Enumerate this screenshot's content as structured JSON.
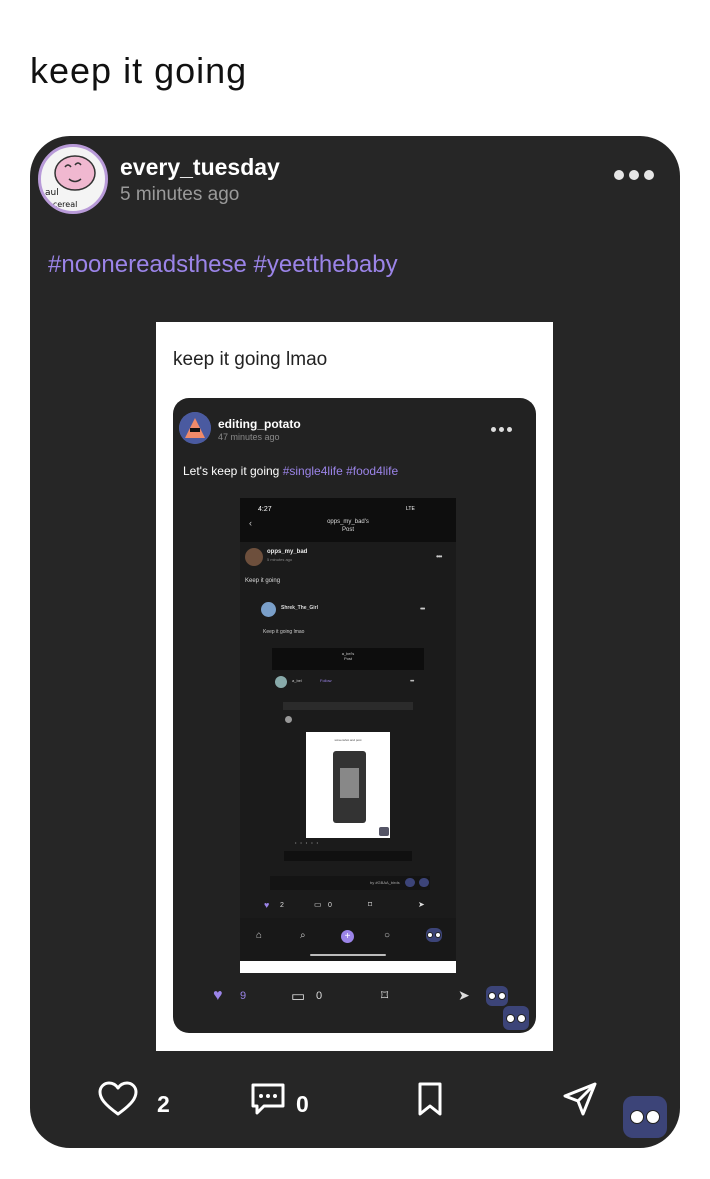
{
  "caption": "keep it going",
  "post": {
    "username": "every_tuesday",
    "time": "5 minutes ago",
    "avatar_text_1": "aul",
    "avatar_text_2": "ts cereal",
    "hashtags": "#noonereadsthese #yeetthebaby",
    "likes": "2",
    "comments": "0"
  },
  "screenshot": {
    "caption": "keep it going lmao",
    "username": "editing_potato",
    "time": "47 minutes ago",
    "text": "Let's keep it going ",
    "hashtags": "#single4life #food4life",
    "likes": "9",
    "comments": "0"
  },
  "nested": {
    "clock": "4:27",
    "signal": "LTE",
    "title_1": "opps_my_bad's",
    "title_2": "Post",
    "username": "opps_my_bad",
    "time": "5 minutes ago",
    "text": "Keep it going",
    "deep_username": "Shrek_The_Girl",
    "deep_text": "Keep it going lmao",
    "deeper_title_1": "a_bel's",
    "deeper_title_2": "Post",
    "deeper_username": "a_bel",
    "deeper_follow": "Follow",
    "deeper_caption": "screenshot and post",
    "credit": "by #GBAA_birds",
    "likes": "2",
    "comments": "0"
  },
  "colors": {
    "card": "#262626",
    "accent": "#9b84e8",
    "text": "#ffffff",
    "muted": "#9a9a9a"
  },
  "icons": [
    "heart-icon",
    "comment-icon",
    "bookmark-icon",
    "share-icon",
    "more-icon",
    "owl-icon",
    "home-icon",
    "search-icon",
    "plus-icon",
    "chat-icon",
    "back-icon"
  ]
}
